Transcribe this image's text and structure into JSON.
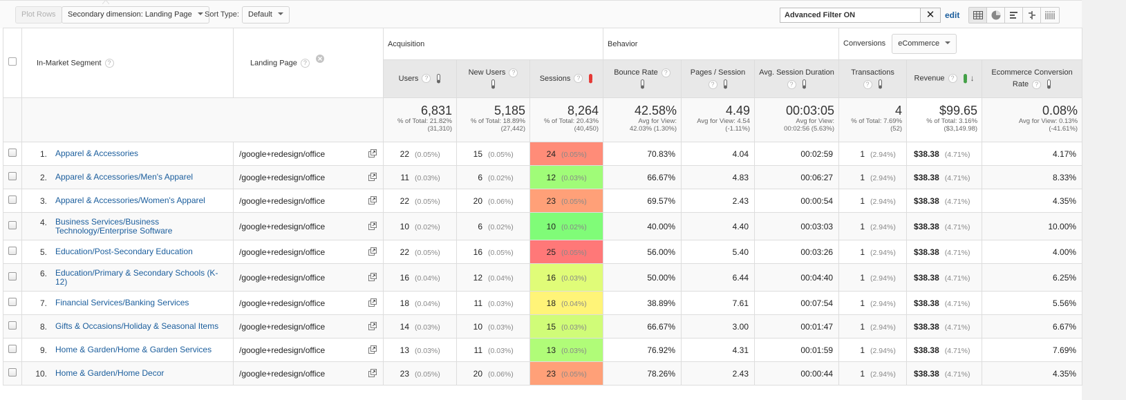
{
  "toolbar": {
    "plot_rows": "Plot Rows",
    "secondary_dimension": "Secondary dimension: Landing Page",
    "sort_type_label": "Sort Type:",
    "sort_type_value": "Default",
    "filter_text": "Advanced Filter ON",
    "filter_clear": "✕",
    "edit": "edit",
    "views": [
      "data-table-view",
      "pie-chart-view",
      "performance-view",
      "comparison-view",
      "term-cloud-view"
    ]
  },
  "headers": {
    "dimension1": "In-Market Segment",
    "dimension2": "Landing Page",
    "groups": {
      "acquisition": "Acquisition",
      "behavior": "Behavior",
      "conversions": "Conversions",
      "conversions_select": "eCommerce"
    },
    "metrics": {
      "users": "Users",
      "new_users": "New Users",
      "sessions": "Sessions",
      "bounce_rate": "Bounce Rate",
      "pages_session": "Pages / Session",
      "avg_session_duration": "Avg. Session Duration",
      "transactions": "Transactions",
      "revenue": "Revenue",
      "ecommerce_conversion_rate_l1": "Ecommerce Conversion",
      "ecommerce_conversion_rate_l2": "Rate"
    },
    "help": "?",
    "sort_indicator": "↓",
    "heatmap_metric": "Sessions",
    "colors": {
      "heat_high": "#e53935",
      "heat_active_sort": "#43a047",
      "link": "#1a5d9c"
    }
  },
  "summary": {
    "users": {
      "value": "6,831",
      "line1": "% of Total: 21.82%",
      "line2": "(31,310)"
    },
    "new_users": {
      "value": "5,185",
      "line1": "% of Total: 18.89%",
      "line2": "(27,442)"
    },
    "sessions": {
      "value": "8,264",
      "line1": "% of Total: 20.43%",
      "line2": "(40,450)"
    },
    "bounce_rate": {
      "value": "42.58%",
      "line1": "Avg for View:",
      "line2": "42.03% (1.30%)"
    },
    "pages_session": {
      "value": "4.49",
      "line1": "Avg for View: 4.54",
      "line2": "(-1.11%)"
    },
    "avg_session_duration": {
      "value": "00:03:05",
      "line1": "Avg for View:",
      "line2": "00:02:56 (5.63%)"
    },
    "transactions": {
      "value": "4",
      "line1": "% of Total: 7.69%",
      "line2": "(52)"
    },
    "revenue": {
      "value": "$99.65",
      "line1": "% of Total: 3.16%",
      "line2": "($3,149.98)"
    },
    "conversion_rate": {
      "value": "0.08%",
      "line1": "Avg for View: 0.13%",
      "line2": "(-41.61%)"
    }
  },
  "rows": [
    {
      "rank": "1.",
      "segment": "Apparel & Accessories",
      "landing_page": "/google+redesign/office",
      "users": "22",
      "users_pct": "(0.05%)",
      "new_users": "15",
      "new_users_pct": "(0.05%)",
      "sessions": "24",
      "sessions_pct": "(0.05%)",
      "sessions_color": "#ff8c78",
      "bounce_rate": "70.83%",
      "pages_session": "4.04",
      "avg_duration": "00:02:59",
      "transactions": "1",
      "transactions_pct": "(2.94%)",
      "revenue": "$38.38",
      "revenue_pct": "(4.71%)",
      "conversion_rate": "4.17%"
    },
    {
      "rank": "2.",
      "segment": "Apparel & Accessories/Men's Apparel",
      "landing_page": "/google+redesign/office",
      "users": "11",
      "users_pct": "(0.03%)",
      "new_users": "6",
      "new_users_pct": "(0.02%)",
      "sessions": "12",
      "sessions_pct": "(0.03%)",
      "sessions_color": "#a0fc78",
      "bounce_rate": "66.67%",
      "pages_session": "4.83",
      "avg_duration": "00:06:27",
      "transactions": "1",
      "transactions_pct": "(2.94%)",
      "revenue": "$38.38",
      "revenue_pct": "(4.71%)",
      "conversion_rate": "8.33%"
    },
    {
      "rank": "3.",
      "segment": "Apparel & Accessories/Women's Apparel",
      "landing_page": "/google+redesign/office",
      "users": "22",
      "users_pct": "(0.05%)",
      "new_users": "20",
      "new_users_pct": "(0.06%)",
      "sessions": "23",
      "sessions_pct": "(0.05%)",
      "sessions_color": "#ffa078",
      "bounce_rate": "69.57%",
      "pages_session": "2.43",
      "avg_duration": "00:00:54",
      "transactions": "1",
      "transactions_pct": "(2.94%)",
      "revenue": "$38.38",
      "revenue_pct": "(4.71%)",
      "conversion_rate": "4.35%"
    },
    {
      "rank": "4.",
      "segment": "Business Services/Business Technology/Enterprise Software",
      "landing_page": "/google+redesign/office",
      "users": "10",
      "users_pct": "(0.02%)",
      "new_users": "6",
      "new_users_pct": "(0.02%)",
      "sessions": "10",
      "sessions_pct": "(0.02%)",
      "sessions_color": "#80fc78",
      "bounce_rate": "40.00%",
      "pages_session": "4.40",
      "avg_duration": "00:03:03",
      "transactions": "1",
      "transactions_pct": "(2.94%)",
      "revenue": "$38.38",
      "revenue_pct": "(4.71%)",
      "conversion_rate": "10.00%"
    },
    {
      "rank": "5.",
      "segment": "Education/Post-Secondary Education",
      "landing_page": "/google+redesign/office",
      "users": "22",
      "users_pct": "(0.05%)",
      "new_users": "16",
      "new_users_pct": "(0.05%)",
      "sessions": "25",
      "sessions_pct": "(0.05%)",
      "sessions_color": "#ff7878",
      "bounce_rate": "56.00%",
      "pages_session": "5.40",
      "avg_duration": "00:03:26",
      "transactions": "1",
      "transactions_pct": "(2.94%)",
      "revenue": "$38.38",
      "revenue_pct": "(4.71%)",
      "conversion_rate": "4.00%"
    },
    {
      "rank": "6.",
      "segment": "Education/Primary & Secondary Schools (K-12)",
      "landing_page": "/google+redesign/office",
      "users": "16",
      "users_pct": "(0.04%)",
      "new_users": "12",
      "new_users_pct": "(0.04%)",
      "sessions": "16",
      "sessions_pct": "(0.03%)",
      "sessions_color": "#e0fc78",
      "bounce_rate": "50.00%",
      "pages_session": "6.44",
      "avg_duration": "00:04:40",
      "transactions": "1",
      "transactions_pct": "(2.94%)",
      "revenue": "$38.38",
      "revenue_pct": "(4.71%)",
      "conversion_rate": "6.25%"
    },
    {
      "rank": "7.",
      "segment": "Financial Services/Banking Services",
      "landing_page": "/google+redesign/office",
      "users": "18",
      "users_pct": "(0.04%)",
      "new_users": "11",
      "new_users_pct": "(0.03%)",
      "sessions": "18",
      "sessions_pct": "(0.04%)",
      "sessions_color": "#fff478",
      "bounce_rate": "38.89%",
      "pages_session": "7.61",
      "avg_duration": "00:07:54",
      "transactions": "1",
      "transactions_pct": "(2.94%)",
      "revenue": "$38.38",
      "revenue_pct": "(4.71%)",
      "conversion_rate": "5.56%"
    },
    {
      "rank": "8.",
      "segment": "Gifts & Occasions/Holiday & Seasonal Items",
      "landing_page": "/google+redesign/office",
      "users": "14",
      "users_pct": "(0.03%)",
      "new_users": "10",
      "new_users_pct": "(0.03%)",
      "sessions": "15",
      "sessions_pct": "(0.03%)",
      "sessions_color": "#d0fc78",
      "bounce_rate": "66.67%",
      "pages_session": "3.00",
      "avg_duration": "00:01:47",
      "transactions": "1",
      "transactions_pct": "(2.94%)",
      "revenue": "$38.38",
      "revenue_pct": "(4.71%)",
      "conversion_rate": "6.67%"
    },
    {
      "rank": "9.",
      "segment": "Home & Garden/Home & Garden Services",
      "landing_page": "/google+redesign/office",
      "users": "13",
      "users_pct": "(0.03%)",
      "new_users": "11",
      "new_users_pct": "(0.03%)",
      "sessions": "13",
      "sessions_pct": "(0.03%)",
      "sessions_color": "#b0fc78",
      "bounce_rate": "76.92%",
      "pages_session": "4.31",
      "avg_duration": "00:01:59",
      "transactions": "1",
      "transactions_pct": "(2.94%)",
      "revenue": "$38.38",
      "revenue_pct": "(4.71%)",
      "conversion_rate": "7.69%"
    },
    {
      "rank": "10.",
      "segment": "Home & Garden/Home Decor",
      "landing_page": "/google+redesign/office",
      "users": "23",
      "users_pct": "(0.05%)",
      "new_users": "20",
      "new_users_pct": "(0.06%)",
      "sessions": "23",
      "sessions_pct": "(0.05%)",
      "sessions_color": "#ffa078",
      "bounce_rate": "78.26%",
      "pages_session": "2.43",
      "avg_duration": "00:00:44",
      "transactions": "1",
      "transactions_pct": "(2.94%)",
      "revenue": "$38.38",
      "revenue_pct": "(4.71%)",
      "conversion_rate": "4.35%"
    }
  ]
}
